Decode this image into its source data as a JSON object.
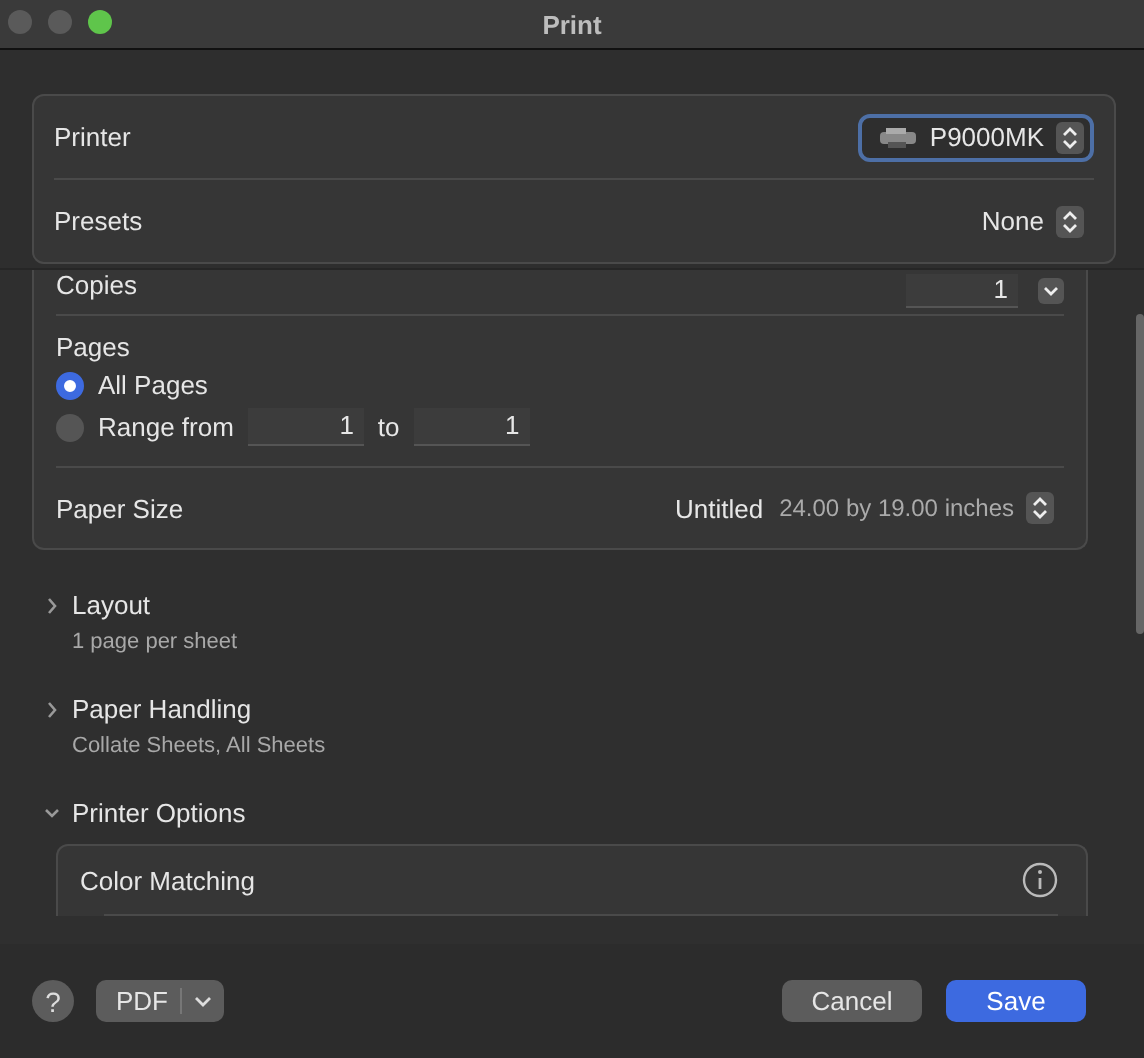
{
  "window": {
    "title": "Print"
  },
  "printer": {
    "label": "Printer",
    "value": "P9000MK",
    "focused": true
  },
  "presets": {
    "label": "Presets",
    "value": "None"
  },
  "copies": {
    "label": "Copies",
    "value": "1"
  },
  "pages": {
    "label": "Pages",
    "options": [
      {
        "label": "All Pages",
        "selected": true
      },
      {
        "label": "Range from",
        "selected": false
      }
    ],
    "range_from": "1",
    "range_to_label": "to",
    "range_to": "1"
  },
  "paper_size": {
    "label": "Paper Size",
    "value": "Untitled",
    "detail": "24.00 by 19.00 inches"
  },
  "sections": [
    {
      "title": "Layout",
      "summary": "1 page per sheet",
      "expanded": false
    },
    {
      "title": "Paper Handling",
      "summary": "Collate Sheets, All Sheets",
      "expanded": false
    },
    {
      "title": "Printer Options",
      "expanded": true
    }
  ],
  "printer_options": {
    "title": "Color Matching"
  },
  "footer": {
    "help": "?",
    "pdf": "PDF",
    "buttons": [
      {
        "label": "Cancel",
        "kind": "secondary"
      },
      {
        "label": "Save",
        "kind": "primary"
      }
    ]
  }
}
